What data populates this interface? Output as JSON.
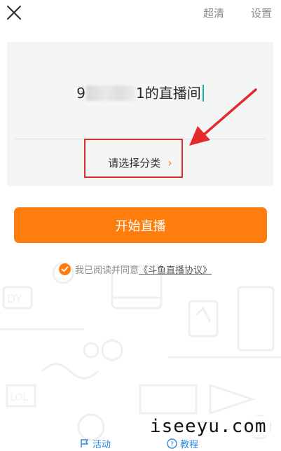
{
  "topbar": {
    "close_icon": "close-icon",
    "quality_label": "超清",
    "settings_label": "设置"
  },
  "room": {
    "title_prefix": "9",
    "title_suffix": "1的直播间",
    "category_label": "请选择分类",
    "category_arrow": "›"
  },
  "start_button": {
    "label": "开始直播"
  },
  "agreement": {
    "prefix": "我已阅读并同意",
    "link": "《斗鱼直播协议》"
  },
  "bottom_links": {
    "activity_label": "活动",
    "tutorial_label": "教程"
  },
  "watermark": {
    "text": "iseeyu.com"
  },
  "colors": {
    "accent": "#ff7d0d",
    "annotation": "#e42b2b",
    "link": "#2e88e0",
    "caret": "#17b4a6"
  }
}
